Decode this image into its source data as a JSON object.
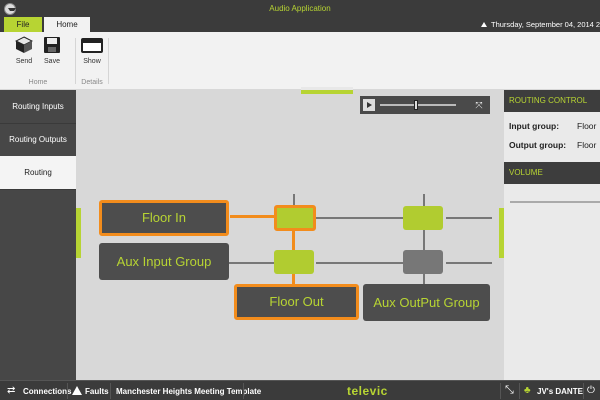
{
  "window": {
    "title": "Audio Application"
  },
  "tabs": {
    "file": "File",
    "home": "Home"
  },
  "datetime": "Thursday, September 04, 2014 2:",
  "ribbon": {
    "send": "Send",
    "save": "Save",
    "show": "Show",
    "group_home": "Home",
    "group_details": "Details"
  },
  "sidebar": {
    "items": [
      {
        "label": "Routing Inputs"
      },
      {
        "label": "Routing Outputs"
      },
      {
        "label": "Routing"
      }
    ]
  },
  "routing": {
    "groups": {
      "floor_in": "Floor In",
      "aux_input": "Aux Input Group",
      "floor_out": "Floor Out",
      "aux_output": "Aux OutPut Group"
    }
  },
  "right_panel": {
    "routing_control": "ROUTING CONTROL",
    "input_group_label": "Input group:",
    "input_group_value": "Floor",
    "output_group_label": "Output group:",
    "output_group_value": "Floor",
    "volume": "VOLUME"
  },
  "statusbar": {
    "connections": "Connections",
    "faults": "Faults",
    "template": "Manchester Heights Meeting Template",
    "logo": "televic",
    "user": "JV's DANTE"
  },
  "colors": {
    "accent": "#b7d433",
    "selection": "#f28c1c",
    "dark": "#3b3b3b"
  },
  "icons": [
    "app-menu-icon",
    "send-icon",
    "save-icon",
    "show-icon",
    "play-icon",
    "fullscreen-icon",
    "connections-icon",
    "faults-icon",
    "expand-icon",
    "user-icon",
    "power-icon"
  ]
}
